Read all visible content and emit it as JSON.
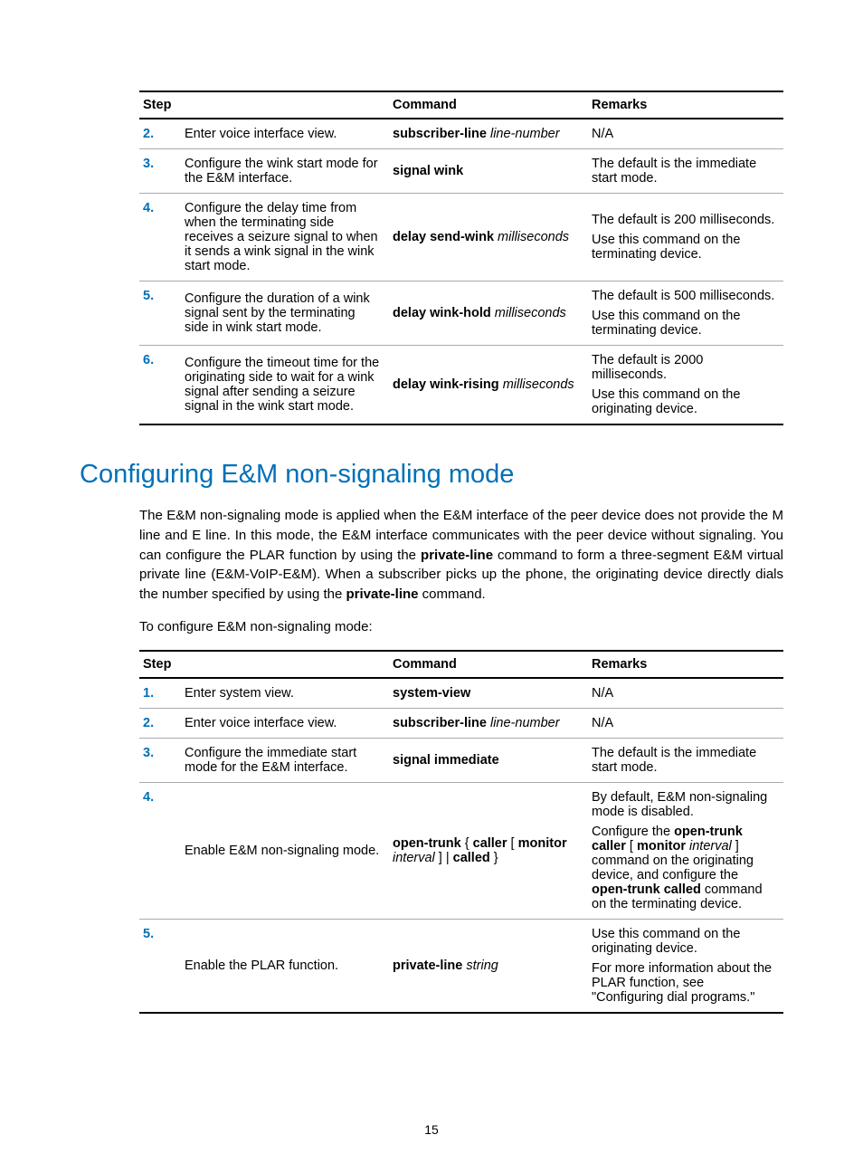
{
  "page_number": "15",
  "table1": {
    "headers": {
      "step": "Step",
      "command": "Command",
      "remarks": "Remarks"
    },
    "rows": [
      {
        "num": "2.",
        "step": "Enter voice interface view.",
        "cmd_bold": "subscriber-line",
        "cmd_ital": "line-number",
        "remarks_html": "N/A"
      },
      {
        "num": "3.",
        "step": "Configure the wink start mode for the E&M interface.",
        "cmd_bold": "signal wink",
        "cmd_ital": "",
        "remarks_html": "The default is the immediate start mode."
      },
      {
        "num": "4.",
        "step": "Configure the delay time from when the terminating side receives a seizure signal to when it sends a wink signal in the wink start mode.",
        "cmd_bold": "delay send-wink",
        "cmd_ital": "milliseconds",
        "remarks_html": "<p>The default is 200 milliseconds.</p><p>Use this command on the terminating device.</p>"
      },
      {
        "num": "5.",
        "step": "Configure the duration of a wink signal sent by the terminating side in wink start mode.",
        "cmd_bold": "delay wink-hold",
        "cmd_ital": "milliseconds",
        "remarks_html": "<p>The default is 500 milliseconds.</p><p>Use this command on the terminating device.</p>"
      },
      {
        "num": "6.",
        "step": "Configure the timeout time for the originating side to wait for a wink signal after sending a seizure signal in the wink start mode.",
        "cmd_bold": "delay wink-rising",
        "cmd_ital": "milliseconds",
        "remarks_html": "<p>The default is 2000 milliseconds.</p><p>Use this command on the originating device.</p>"
      }
    ]
  },
  "section_heading": "Configuring E&M non-signaling mode",
  "para1": "The E&M non-signaling mode is applied when the E&M interface of the peer device does not provide the M line and E line. In this mode, the E&M interface communicates with the peer device without signaling. You can configure the PLAR function by using the <b>private-line</b> command to form a three-segment E&M virtual private line (E&M-VoIP-E&M). When a subscriber picks up the phone, the originating device directly dials the number specified by using the <b>private-line</b> command.",
  "para2": "To configure E&M non-signaling mode:",
  "table2": {
    "headers": {
      "step": "Step",
      "command": "Command",
      "remarks": "Remarks"
    },
    "rows": [
      {
        "num": "1.",
        "step": "Enter system view.",
        "cmd_html": "<b>system-view</b>",
        "remarks_html": "N/A"
      },
      {
        "num": "2.",
        "step": "Enter voice interface view.",
        "cmd_html": "<b>subscriber-line</b> <i>line-number</i>",
        "remarks_html": "N/A"
      },
      {
        "num": "3.",
        "step": "Configure the immediate start mode for the E&M interface.",
        "cmd_html": "<b>signal immediate</b>",
        "remarks_html": "The default is the immediate start mode."
      },
      {
        "num": "4.",
        "step": "Enable E&M non-signaling mode.",
        "cmd_html": "<b>open-trunk</b> { <b>caller</b> [ <b>monitor</b> <i>interval</i> ] | <b>called</b> }",
        "remarks_html": "<p>By default, E&M non-signaling mode is disabled.</p><p>Configure the <b>open-trunk caller</b> [ <b>monitor</b> <i>interval</i> ] command on the originating device, and configure the <b>open-trunk called</b> command on the terminating device.</p>"
      },
      {
        "num": "5.",
        "step": "Enable the PLAR function.",
        "cmd_html": "<b>private-line</b> <i>string</i>",
        "remarks_html": "<p>Use this command on the originating device.</p><p>For more information about the PLAR function, see \"Configuring dial programs.\"</p>"
      }
    ]
  }
}
